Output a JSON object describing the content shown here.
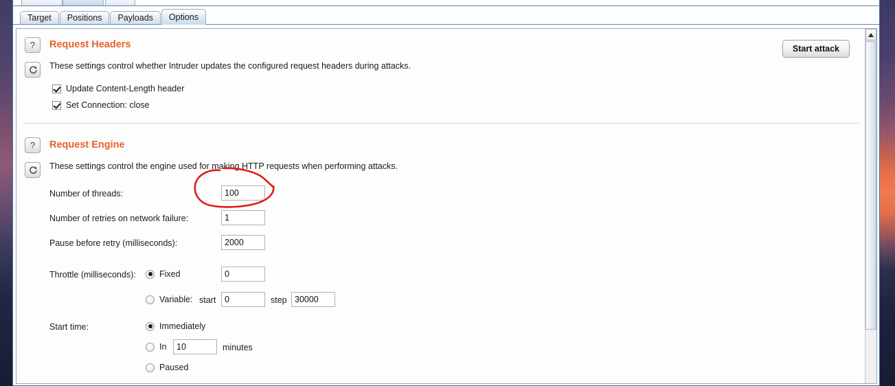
{
  "window": {
    "top_tabs_partial": [
      "",
      "",
      ""
    ]
  },
  "tabbar": {
    "tabs": [
      {
        "label": "Target",
        "active": false
      },
      {
        "label": "Positions",
        "active": false
      },
      {
        "label": "Payloads",
        "active": false
      },
      {
        "label": "Options",
        "active": true
      }
    ]
  },
  "toolbar": {
    "start_attack_label": "Start attack"
  },
  "sections": [
    {
      "id": "request-headers",
      "title": "Request Headers",
      "description": "These settings control whether Intruder updates the configured request headers during attacks.",
      "help_icon": "question-mark-icon",
      "reset_icon": "refresh-icon",
      "checkboxes": [
        {
          "label": "Update Content-Length header",
          "checked": true
        },
        {
          "label": "Set Connection: close",
          "checked": true
        }
      ]
    },
    {
      "id": "request-engine",
      "title": "Request Engine",
      "description": "These settings control the engine used for making HTTP requests when performing attacks.",
      "help_icon": "question-mark-icon",
      "reset_icon": "refresh-icon",
      "fields": {
        "threads_label": "Number of threads:",
        "threads_value": "100",
        "retries_label": "Number of retries on network failure:",
        "retries_value": "1",
        "pause_label": "Pause before retry (milliseconds):",
        "pause_value": "2000",
        "throttle_label": "Throttle (milliseconds):",
        "throttle_fixed_label": "Fixed",
        "throttle_fixed_value": "0",
        "throttle_fixed_selected": true,
        "throttle_variable_label": "Variable:",
        "throttle_variable_selected": false,
        "throttle_start_label": "start",
        "throttle_start_value": "0",
        "throttle_step_label": "step",
        "throttle_step_value": "30000",
        "starttime_label": "Start time:",
        "starttime_immediately_label": "Immediately",
        "starttime_immediately_selected": true,
        "starttime_in_label": "In",
        "starttime_in_value": "10",
        "starttime_in_selected": false,
        "starttime_minutes_label": "minutes",
        "starttime_paused_label": "Paused",
        "starttime_paused_selected": false
      }
    }
  ],
  "annotation": {
    "name": "red-circle-annotation",
    "target": "threads-input",
    "color": "#e01b1b"
  },
  "colors": {
    "section_title": "#e8622a",
    "window_border": "#3f6fa8",
    "annotation_red": "#e01b1b"
  }
}
